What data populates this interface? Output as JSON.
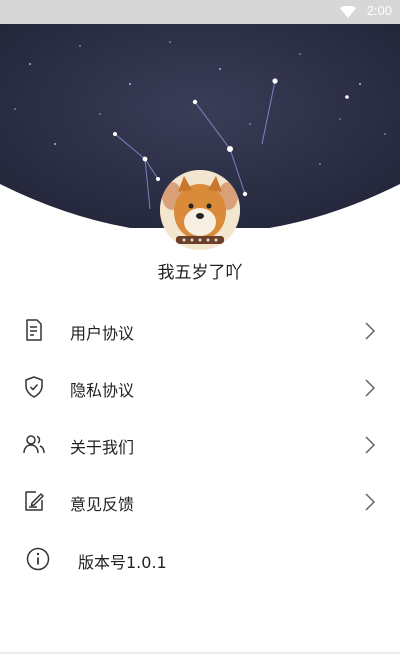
{
  "status_bar": {
    "time": "2:00",
    "wifi_icon": "wifi-icon"
  },
  "profile": {
    "username": "我五岁了吖",
    "avatar": "dog-avatar"
  },
  "menu": [
    {
      "label": "用户协议",
      "icon": "document-icon"
    },
    {
      "label": "隐私协议",
      "icon": "shield-check-icon"
    },
    {
      "label": "关于我们",
      "icon": "users-icon"
    },
    {
      "label": "意见反馈",
      "icon": "feedback-edit-icon"
    }
  ],
  "version": {
    "label": "版本号1.0.1",
    "icon": "info-icon"
  },
  "colors": {
    "header_bg": "#2b2e45",
    "status_bar": "#d7d7d7",
    "text": "#222222",
    "icon": "#333333"
  }
}
